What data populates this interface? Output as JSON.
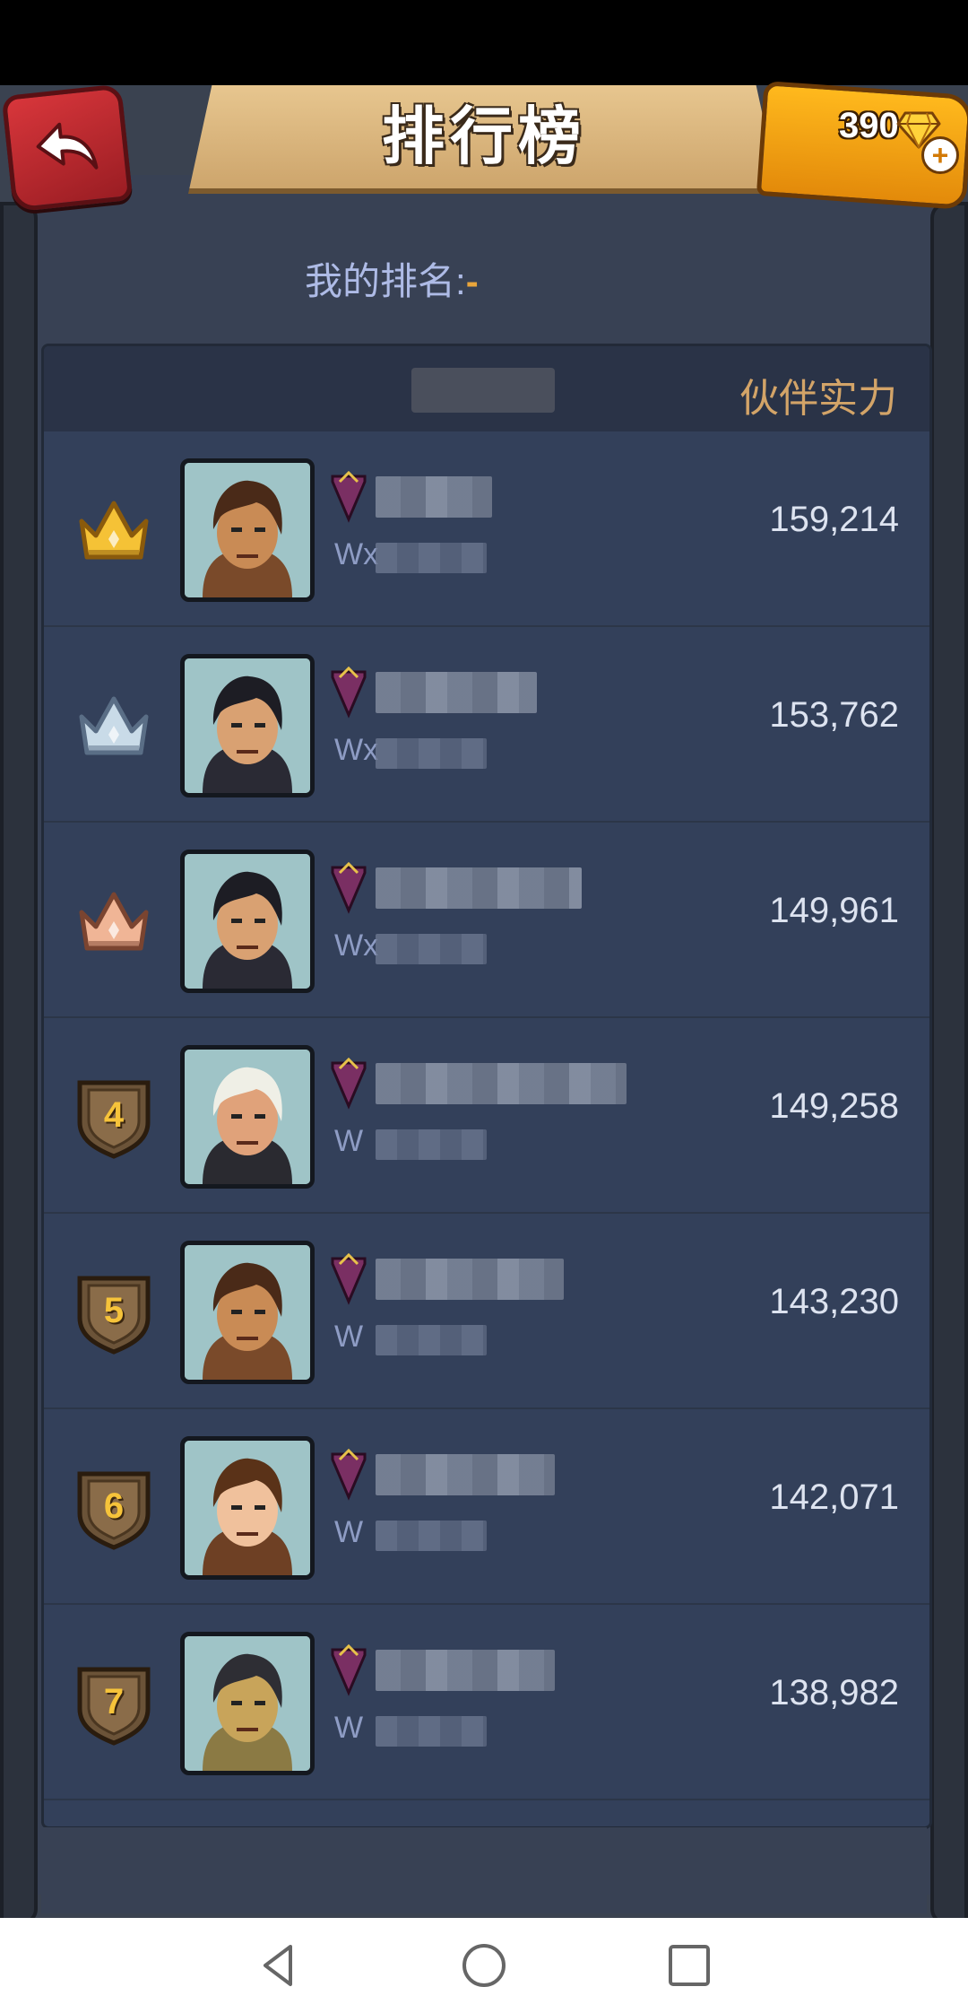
{
  "header": {
    "title": "排行榜",
    "gems": "390",
    "plus": "+"
  },
  "my_rank": {
    "prefix": "我的",
    "label": "排名:",
    "value": "-"
  },
  "table": {
    "column_power": "伙伴实力",
    "rows": [
      {
        "rank": "1",
        "badge": "gold-crown",
        "power": "159,214",
        "sub_prefix": "Wx",
        "hero": "bearded-warrior"
      },
      {
        "rank": "2",
        "badge": "silver-crown",
        "power": "153,762",
        "sub_prefix": "Wx",
        "hero": "dark-haired-hero"
      },
      {
        "rank": "3",
        "badge": "bronze-crown",
        "power": "149,961",
        "sub_prefix": "Wx",
        "hero": "dark-haired-hero"
      },
      {
        "rank": "4",
        "badge": "shield",
        "power": "149,258",
        "sub_prefix": "W",
        "hero": "white-haired-woman"
      },
      {
        "rank": "5",
        "badge": "shield",
        "power": "143,230",
        "sub_prefix": "W",
        "hero": "bearded-warrior"
      },
      {
        "rank": "6",
        "badge": "shield",
        "power": "142,071",
        "sub_prefix": "W",
        "hero": "brown-haired-woman"
      },
      {
        "rank": "7",
        "badge": "shield",
        "power": "138,982",
        "sub_prefix": "W",
        "hero": "armored-beast"
      }
    ]
  },
  "colors": {
    "background": "#384154",
    "panel": "#33405a",
    "header_text": "#d3a468",
    "rank_dash": "#e9a53b",
    "gold": "#f6c33a",
    "back_button": "#d8363b"
  },
  "nav": {
    "back": "nav-back-icon",
    "home": "nav-home-icon",
    "recent": "nav-recent-icon"
  }
}
